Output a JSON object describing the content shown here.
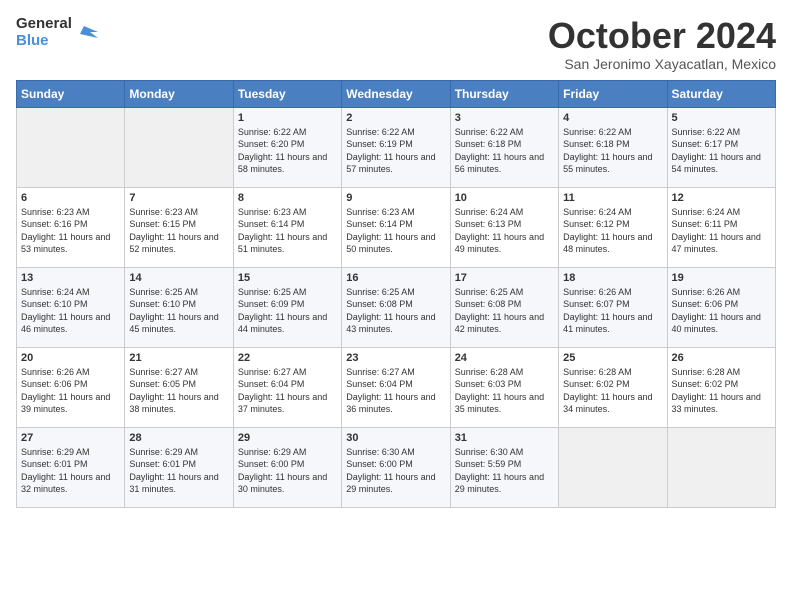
{
  "header": {
    "logo_line1": "General",
    "logo_line2": "Blue",
    "month": "October 2024",
    "location": "San Jeronimo Xayacatlan, Mexico"
  },
  "days_of_week": [
    "Sunday",
    "Monday",
    "Tuesday",
    "Wednesday",
    "Thursday",
    "Friday",
    "Saturday"
  ],
  "weeks": [
    [
      {
        "day": "",
        "info": ""
      },
      {
        "day": "",
        "info": ""
      },
      {
        "day": "1",
        "sunrise": "6:22 AM",
        "sunset": "6:20 PM",
        "daylight": "11 hours and 58 minutes."
      },
      {
        "day": "2",
        "sunrise": "6:22 AM",
        "sunset": "6:19 PM",
        "daylight": "11 hours and 57 minutes."
      },
      {
        "day": "3",
        "sunrise": "6:22 AM",
        "sunset": "6:18 PM",
        "daylight": "11 hours and 56 minutes."
      },
      {
        "day": "4",
        "sunrise": "6:22 AM",
        "sunset": "6:18 PM",
        "daylight": "11 hours and 55 minutes."
      },
      {
        "day": "5",
        "sunrise": "6:22 AM",
        "sunset": "6:17 PM",
        "daylight": "11 hours and 54 minutes."
      }
    ],
    [
      {
        "day": "6",
        "sunrise": "6:23 AM",
        "sunset": "6:16 PM",
        "daylight": "11 hours and 53 minutes."
      },
      {
        "day": "7",
        "sunrise": "6:23 AM",
        "sunset": "6:15 PM",
        "daylight": "11 hours and 52 minutes."
      },
      {
        "day": "8",
        "sunrise": "6:23 AM",
        "sunset": "6:14 PM",
        "daylight": "11 hours and 51 minutes."
      },
      {
        "day": "9",
        "sunrise": "6:23 AM",
        "sunset": "6:14 PM",
        "daylight": "11 hours and 50 minutes."
      },
      {
        "day": "10",
        "sunrise": "6:24 AM",
        "sunset": "6:13 PM",
        "daylight": "11 hours and 49 minutes."
      },
      {
        "day": "11",
        "sunrise": "6:24 AM",
        "sunset": "6:12 PM",
        "daylight": "11 hours and 48 minutes."
      },
      {
        "day": "12",
        "sunrise": "6:24 AM",
        "sunset": "6:11 PM",
        "daylight": "11 hours and 47 minutes."
      }
    ],
    [
      {
        "day": "13",
        "sunrise": "6:24 AM",
        "sunset": "6:10 PM",
        "daylight": "11 hours and 46 minutes."
      },
      {
        "day": "14",
        "sunrise": "6:25 AM",
        "sunset": "6:10 PM",
        "daylight": "11 hours and 45 minutes."
      },
      {
        "day": "15",
        "sunrise": "6:25 AM",
        "sunset": "6:09 PM",
        "daylight": "11 hours and 44 minutes."
      },
      {
        "day": "16",
        "sunrise": "6:25 AM",
        "sunset": "6:08 PM",
        "daylight": "11 hours and 43 minutes."
      },
      {
        "day": "17",
        "sunrise": "6:25 AM",
        "sunset": "6:08 PM",
        "daylight": "11 hours and 42 minutes."
      },
      {
        "day": "18",
        "sunrise": "6:26 AM",
        "sunset": "6:07 PM",
        "daylight": "11 hours and 41 minutes."
      },
      {
        "day": "19",
        "sunrise": "6:26 AM",
        "sunset": "6:06 PM",
        "daylight": "11 hours and 40 minutes."
      }
    ],
    [
      {
        "day": "20",
        "sunrise": "6:26 AM",
        "sunset": "6:06 PM",
        "daylight": "11 hours and 39 minutes."
      },
      {
        "day": "21",
        "sunrise": "6:27 AM",
        "sunset": "6:05 PM",
        "daylight": "11 hours and 38 minutes."
      },
      {
        "day": "22",
        "sunrise": "6:27 AM",
        "sunset": "6:04 PM",
        "daylight": "11 hours and 37 minutes."
      },
      {
        "day": "23",
        "sunrise": "6:27 AM",
        "sunset": "6:04 PM",
        "daylight": "11 hours and 36 minutes."
      },
      {
        "day": "24",
        "sunrise": "6:28 AM",
        "sunset": "6:03 PM",
        "daylight": "11 hours and 35 minutes."
      },
      {
        "day": "25",
        "sunrise": "6:28 AM",
        "sunset": "6:02 PM",
        "daylight": "11 hours and 34 minutes."
      },
      {
        "day": "26",
        "sunrise": "6:28 AM",
        "sunset": "6:02 PM",
        "daylight": "11 hours and 33 minutes."
      }
    ],
    [
      {
        "day": "27",
        "sunrise": "6:29 AM",
        "sunset": "6:01 PM",
        "daylight": "11 hours and 32 minutes."
      },
      {
        "day": "28",
        "sunrise": "6:29 AM",
        "sunset": "6:01 PM",
        "daylight": "11 hours and 31 minutes."
      },
      {
        "day": "29",
        "sunrise": "6:29 AM",
        "sunset": "6:00 PM",
        "daylight": "11 hours and 30 minutes."
      },
      {
        "day": "30",
        "sunrise": "6:30 AM",
        "sunset": "6:00 PM",
        "daylight": "11 hours and 29 minutes."
      },
      {
        "day": "31",
        "sunrise": "6:30 AM",
        "sunset": "5:59 PM",
        "daylight": "11 hours and 29 minutes."
      },
      {
        "day": "",
        "info": ""
      },
      {
        "day": "",
        "info": ""
      }
    ]
  ],
  "labels": {
    "sunrise": "Sunrise:",
    "sunset": "Sunset:",
    "daylight": "Daylight:"
  }
}
